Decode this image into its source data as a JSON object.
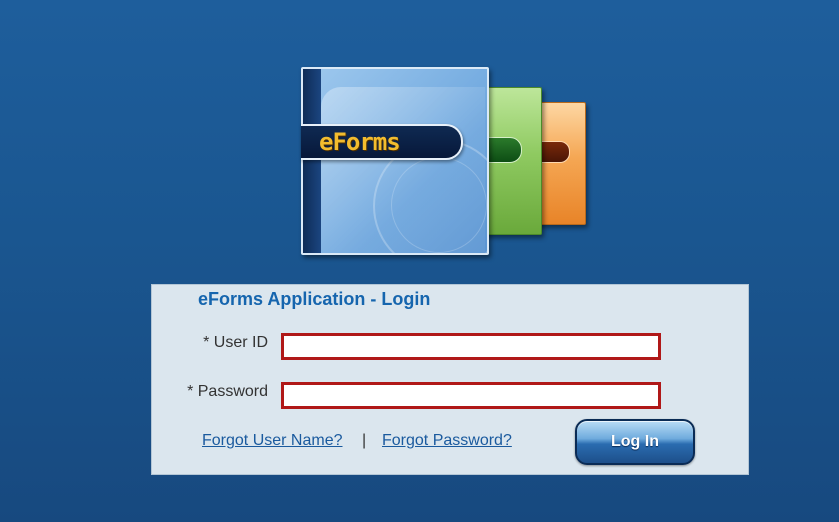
{
  "logo": {
    "text": "eForms",
    "colors": {
      "blue_folder": "#74abe0",
      "green_folder": "#8fca61",
      "orange_folder": "#f5a754",
      "label_text": "#f2bc2e"
    }
  },
  "login": {
    "title": "eForms Application - Login",
    "userid_label": "* User ID",
    "userid_value": "",
    "password_label": "* Password",
    "password_value": "",
    "forgot_username": "Forgot User Name?",
    "separator": "|",
    "forgot_password": "Forgot Password?",
    "login_button": "Log In"
  },
  "theme": {
    "background": "#1a5690",
    "panel_background": "#dbe6ee",
    "title_color": "#1565ae",
    "input_border": "#b01818",
    "link_color": "#1a5a9e"
  }
}
